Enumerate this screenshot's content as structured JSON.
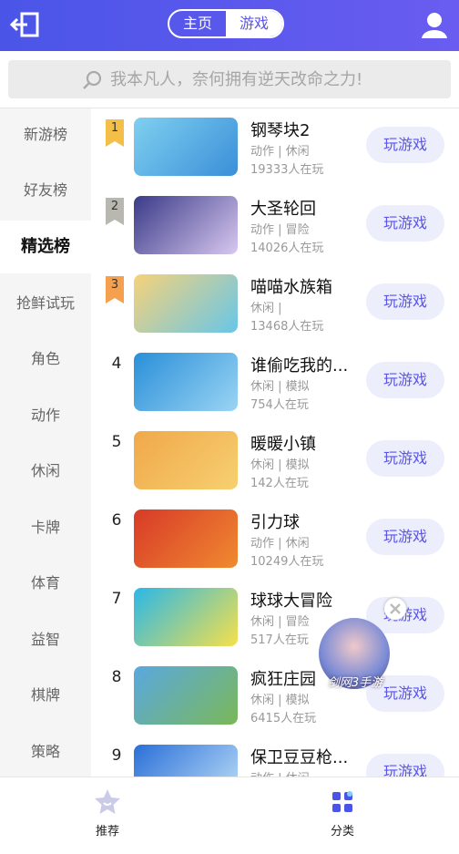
{
  "header": {
    "segments": [
      {
        "label": "主页",
        "active": false
      },
      {
        "label": "游戏",
        "active": true
      }
    ],
    "back_icon": "exit-arrow-icon",
    "user_icon": "user-avatar-icon",
    "accent_color": "#5a55e6"
  },
  "search": {
    "placeholder": "我本凡人，奈何拥有逆天改命之力!",
    "icon": "search-icon"
  },
  "sidebar": {
    "items": [
      {
        "label": "新游榜",
        "active": false
      },
      {
        "label": "好友榜",
        "active": false
      },
      {
        "label": "精选榜",
        "active": true
      },
      {
        "label": "抢鲜试玩",
        "active": false
      },
      {
        "label": "角色",
        "active": false
      },
      {
        "label": "动作",
        "active": false
      },
      {
        "label": "休闲",
        "active": false
      },
      {
        "label": "卡牌",
        "active": false
      },
      {
        "label": "体育",
        "active": false
      },
      {
        "label": "益智",
        "active": false
      },
      {
        "label": "棋牌",
        "active": false
      },
      {
        "label": "策略",
        "active": false
      }
    ]
  },
  "games": [
    {
      "rank": "1",
      "title": "钢琴块2",
      "tags": "动作 | 休闲",
      "players": "19333人在玩",
      "play_label": "玩游戏",
      "thumb_colors": [
        "#7fd0f0",
        "#3a8fd8"
      ]
    },
    {
      "rank": "2",
      "title": "大圣轮回",
      "tags": "动作 | 冒险",
      "players": "14026人在玩",
      "play_label": "玩游戏",
      "thumb_colors": [
        "#3a3a88",
        "#d8c8f0"
      ]
    },
    {
      "rank": "3",
      "title": "喵喵水族箱",
      "tags": "休闲 |",
      "players": "13468人在玩",
      "play_label": "玩游戏",
      "thumb_colors": [
        "#f6d27a",
        "#68c6e8"
      ]
    },
    {
      "rank": "4",
      "title": "谁偷吃我的...",
      "tags": "休闲 | 模拟",
      "players": "754人在玩",
      "play_label": "玩游戏",
      "thumb_colors": [
        "#2a8fd8",
        "#9ad4f4"
      ]
    },
    {
      "rank": "5",
      "title": "暖暖小镇",
      "tags": "休闲 | 模拟",
      "players": "142人在玩",
      "play_label": "玩游戏",
      "thumb_colors": [
        "#f0a84a",
        "#f6d070"
      ]
    },
    {
      "rank": "6",
      "title": "引力球",
      "tags": "动作 | 休闲",
      "players": "10249人在玩",
      "play_label": "玩游戏",
      "thumb_colors": [
        "#d83a28",
        "#f08a30"
      ]
    },
    {
      "rank": "7",
      "title": "球球大冒险",
      "tags": "休闲 | 冒险",
      "players": "517人在玩",
      "play_label": "玩游戏",
      "thumb_colors": [
        "#2ab8e8",
        "#f6e04a"
      ]
    },
    {
      "rank": "8",
      "title": "疯狂庄园",
      "tags": "休闲 | 模拟",
      "players": "6415人在玩",
      "play_label": "玩游戏",
      "thumb_colors": [
        "#5aa8e0",
        "#7ab858"
      ]
    },
    {
      "rank": "9",
      "title": "保卫豆豆枪...",
      "tags": "动作 | 休闲",
      "players": "",
      "play_label": "玩游戏",
      "thumb_colors": [
        "#2a6fd8",
        "#bfe0f8"
      ]
    }
  ],
  "floating_ad": {
    "label": "剑网3手游"
  },
  "bottom_nav": {
    "tabs": [
      {
        "label": "推荐",
        "icon": "star-icon",
        "active": false
      },
      {
        "label": "分类",
        "icon": "grid-icon",
        "active": true
      }
    ]
  }
}
